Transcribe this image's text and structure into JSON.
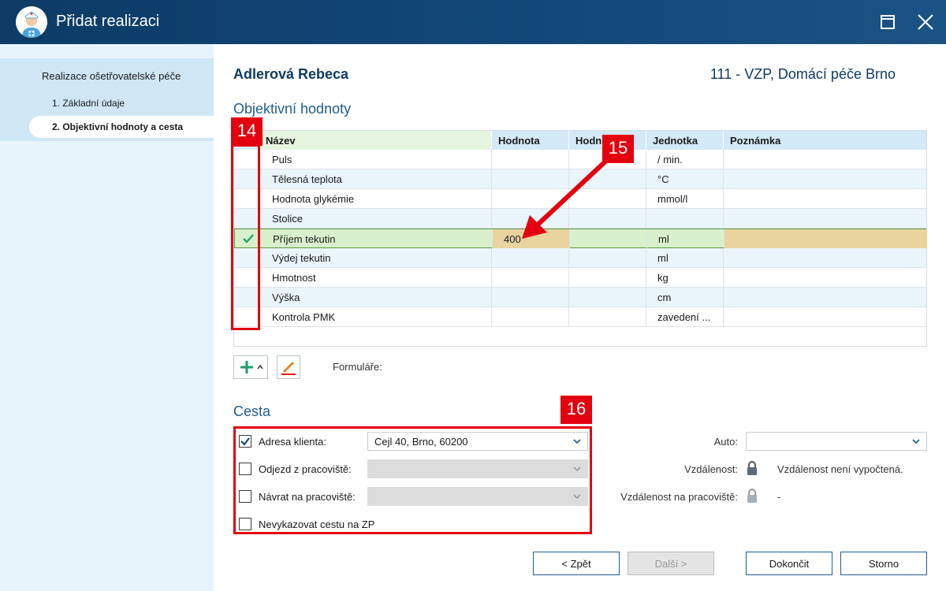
{
  "window": {
    "title": "Přidat realizaci",
    "icon": "nurse-avatar-icon",
    "controls": [
      "maximize-icon",
      "close-icon"
    ]
  },
  "sidebar": {
    "section": "Realizace ošetřovatelské péče",
    "steps": [
      {
        "label": "1. Základní údaje",
        "active": false
      },
      {
        "label": "2. Objektivní hodnoty a cesta",
        "active": true
      }
    ]
  },
  "header": {
    "patient": "Adlerová Rebeca",
    "insurer": "111 - VZP, Domácí péče Brno"
  },
  "objective": {
    "title": "Objektivní hodnoty",
    "columns": [
      "Název",
      "Hodnota",
      "Hodn",
      "Jednotka",
      "Poznámka"
    ],
    "rows": [
      {
        "name": "Puls",
        "value": "",
        "unit": "/ min.",
        "checked": false
      },
      {
        "name": "Tělesná teplota",
        "value": "",
        "unit": "°C",
        "checked": false
      },
      {
        "name": "Hodnota glykémie",
        "value": "",
        "unit": "mmol/l",
        "checked": false
      },
      {
        "name": "Stolice",
        "value": "",
        "unit": "",
        "checked": false
      },
      {
        "name": "Příjem tekutin",
        "value": "400",
        "unit": "ml",
        "checked": true
      },
      {
        "name": "Výdej tekutin",
        "value": "",
        "unit": "ml",
        "checked": false
      },
      {
        "name": "Hmotnost",
        "value": "",
        "unit": "kg",
        "checked": false
      },
      {
        "name": "Výška",
        "value": "",
        "unit": "cm",
        "checked": false
      },
      {
        "name": "Kontrola PMK",
        "value": "",
        "unit": "zavedení ...",
        "checked": false
      }
    ],
    "toolbar": {
      "add": "plus-icon",
      "edit": "pencil-icon",
      "forms_label": "Formuláře:"
    }
  },
  "cesta": {
    "title": "Cesta",
    "items": [
      {
        "label": "Adresa klienta:",
        "checked": true,
        "value": "Cejl 40, Brno, 60200",
        "enabled": true
      },
      {
        "label": "Odjezd z pracoviště:",
        "checked": false,
        "value": "",
        "enabled": false
      },
      {
        "label": "Návrat na pracoviště:",
        "checked": false,
        "value": "",
        "enabled": false
      },
      {
        "label": "Nevykazovat cestu na ZP",
        "checked": false
      }
    ],
    "auto_label": "Auto:",
    "auto_value": "",
    "distance_label": "Vzdálenost:",
    "distance_value": "Vzdálenost není vypočtená.",
    "distance_work_label": "Vzdálenost na pracoviště:",
    "distance_work_value": "-"
  },
  "buttons": {
    "back": "< Zpět",
    "next": "Další >",
    "finish": "Dokončit",
    "cancel": "Storno"
  },
  "annotations": {
    "tag14": "14",
    "tag15": "15",
    "tag16": "16",
    "color": "#e3000f"
  },
  "colors": {
    "titlebar": "#0d3b66",
    "accent": "#1f5c8f",
    "selected_row": "#d9f0cc",
    "edited_cell": "#e9d4a0"
  }
}
